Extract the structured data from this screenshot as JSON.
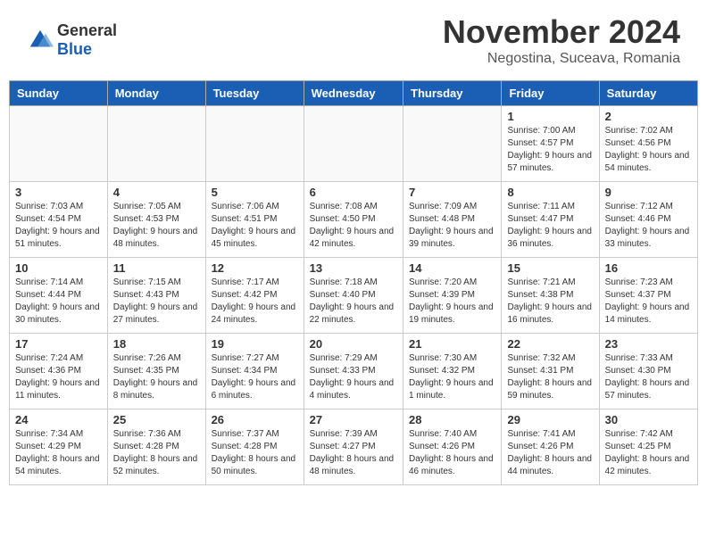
{
  "header": {
    "logo_general": "General",
    "logo_blue": "Blue",
    "month_title": "November 2024",
    "location": "Negostina, Suceava, Romania"
  },
  "days_of_week": [
    "Sunday",
    "Monday",
    "Tuesday",
    "Wednesday",
    "Thursday",
    "Friday",
    "Saturday"
  ],
  "weeks": [
    [
      {
        "day": "",
        "info": ""
      },
      {
        "day": "",
        "info": ""
      },
      {
        "day": "",
        "info": ""
      },
      {
        "day": "",
        "info": ""
      },
      {
        "day": "",
        "info": ""
      },
      {
        "day": "1",
        "info": "Sunrise: 7:00 AM\nSunset: 4:57 PM\nDaylight: 9 hours and 57 minutes."
      },
      {
        "day": "2",
        "info": "Sunrise: 7:02 AM\nSunset: 4:56 PM\nDaylight: 9 hours and 54 minutes."
      }
    ],
    [
      {
        "day": "3",
        "info": "Sunrise: 7:03 AM\nSunset: 4:54 PM\nDaylight: 9 hours and 51 minutes."
      },
      {
        "day": "4",
        "info": "Sunrise: 7:05 AM\nSunset: 4:53 PM\nDaylight: 9 hours and 48 minutes."
      },
      {
        "day": "5",
        "info": "Sunrise: 7:06 AM\nSunset: 4:51 PM\nDaylight: 9 hours and 45 minutes."
      },
      {
        "day": "6",
        "info": "Sunrise: 7:08 AM\nSunset: 4:50 PM\nDaylight: 9 hours and 42 minutes."
      },
      {
        "day": "7",
        "info": "Sunrise: 7:09 AM\nSunset: 4:48 PM\nDaylight: 9 hours and 39 minutes."
      },
      {
        "day": "8",
        "info": "Sunrise: 7:11 AM\nSunset: 4:47 PM\nDaylight: 9 hours and 36 minutes."
      },
      {
        "day": "9",
        "info": "Sunrise: 7:12 AM\nSunset: 4:46 PM\nDaylight: 9 hours and 33 minutes."
      }
    ],
    [
      {
        "day": "10",
        "info": "Sunrise: 7:14 AM\nSunset: 4:44 PM\nDaylight: 9 hours and 30 minutes."
      },
      {
        "day": "11",
        "info": "Sunrise: 7:15 AM\nSunset: 4:43 PM\nDaylight: 9 hours and 27 minutes."
      },
      {
        "day": "12",
        "info": "Sunrise: 7:17 AM\nSunset: 4:42 PM\nDaylight: 9 hours and 24 minutes."
      },
      {
        "day": "13",
        "info": "Sunrise: 7:18 AM\nSunset: 4:40 PM\nDaylight: 9 hours and 22 minutes."
      },
      {
        "day": "14",
        "info": "Sunrise: 7:20 AM\nSunset: 4:39 PM\nDaylight: 9 hours and 19 minutes."
      },
      {
        "day": "15",
        "info": "Sunrise: 7:21 AM\nSunset: 4:38 PM\nDaylight: 9 hours and 16 minutes."
      },
      {
        "day": "16",
        "info": "Sunrise: 7:23 AM\nSunset: 4:37 PM\nDaylight: 9 hours and 14 minutes."
      }
    ],
    [
      {
        "day": "17",
        "info": "Sunrise: 7:24 AM\nSunset: 4:36 PM\nDaylight: 9 hours and 11 minutes."
      },
      {
        "day": "18",
        "info": "Sunrise: 7:26 AM\nSunset: 4:35 PM\nDaylight: 9 hours and 8 minutes."
      },
      {
        "day": "19",
        "info": "Sunrise: 7:27 AM\nSunset: 4:34 PM\nDaylight: 9 hours and 6 minutes."
      },
      {
        "day": "20",
        "info": "Sunrise: 7:29 AM\nSunset: 4:33 PM\nDaylight: 9 hours and 4 minutes."
      },
      {
        "day": "21",
        "info": "Sunrise: 7:30 AM\nSunset: 4:32 PM\nDaylight: 9 hours and 1 minute."
      },
      {
        "day": "22",
        "info": "Sunrise: 7:32 AM\nSunset: 4:31 PM\nDaylight: 8 hours and 59 minutes."
      },
      {
        "day": "23",
        "info": "Sunrise: 7:33 AM\nSunset: 4:30 PM\nDaylight: 8 hours and 57 minutes."
      }
    ],
    [
      {
        "day": "24",
        "info": "Sunrise: 7:34 AM\nSunset: 4:29 PM\nDaylight: 8 hours and 54 minutes."
      },
      {
        "day": "25",
        "info": "Sunrise: 7:36 AM\nSunset: 4:28 PM\nDaylight: 8 hours and 52 minutes."
      },
      {
        "day": "26",
        "info": "Sunrise: 7:37 AM\nSunset: 4:28 PM\nDaylight: 8 hours and 50 minutes."
      },
      {
        "day": "27",
        "info": "Sunrise: 7:39 AM\nSunset: 4:27 PM\nDaylight: 8 hours and 48 minutes."
      },
      {
        "day": "28",
        "info": "Sunrise: 7:40 AM\nSunset: 4:26 PM\nDaylight: 8 hours and 46 minutes."
      },
      {
        "day": "29",
        "info": "Sunrise: 7:41 AM\nSunset: 4:26 PM\nDaylight: 8 hours and 44 minutes."
      },
      {
        "day": "30",
        "info": "Sunrise: 7:42 AM\nSunset: 4:25 PM\nDaylight: 8 hours and 42 minutes."
      }
    ]
  ]
}
